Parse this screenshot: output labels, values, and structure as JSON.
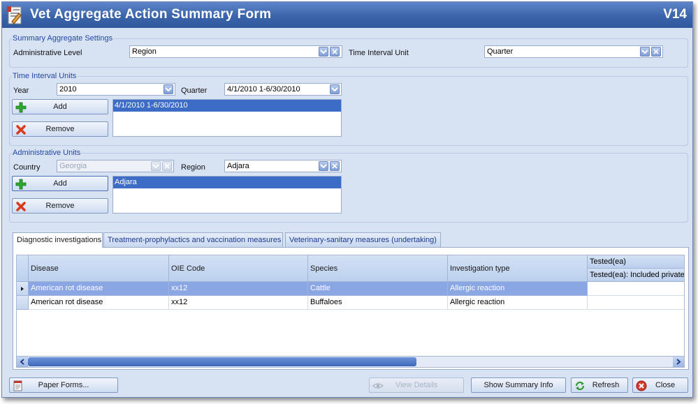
{
  "window": {
    "title": "Vet Aggregate Action Summary Form",
    "version": "V14"
  },
  "summary_settings": {
    "group_title": "Summary Aggregate Settings",
    "admin_level_label": "Administrative Level",
    "admin_level_value": "Region",
    "time_unit_label": "Time Interval Unit",
    "time_unit_value": "Quarter"
  },
  "time_interval_units": {
    "group_title": "Time Interval Units",
    "year_label": "Year",
    "year_value": "2010",
    "quarter_label": "Quarter",
    "quarter_value": "4/1/2010 1-6/30/2010",
    "add_label": "Add",
    "remove_label": "Remove",
    "list_items": [
      "4/1/2010 1-6/30/2010"
    ]
  },
  "administrative_units": {
    "group_title": "Administrative Units",
    "country_label": "Country",
    "country_value": "Georgia",
    "region_label": "Region",
    "region_value": "Adjara",
    "add_label": "Add",
    "remove_label": "Remove",
    "list_items": [
      "Adjara"
    ]
  },
  "tabs": [
    {
      "label": "Diagnostic investigations",
      "active": true
    },
    {
      "label": "Treatment-prophylactics and vaccination measures",
      "active": false
    },
    {
      "label": "Veterinary-sanitary measures (undertaking)",
      "active": false
    }
  ],
  "grid": {
    "columns": [
      "Disease",
      "OIE Code",
      "Species",
      "Investigation type"
    ],
    "group_column": "Tested(ea)",
    "group_subcolumn": "Tested(ea): Included private",
    "rows": [
      {
        "disease": "American rot disease",
        "oie": "xx12",
        "species": "Cattle",
        "type": "Allergic reaction",
        "selected": true
      },
      {
        "disease": "American rot disease",
        "oie": "xx12",
        "species": "Buffaloes",
        "type": "Allergic reaction",
        "selected": false
      }
    ]
  },
  "footer": {
    "paper_forms": "Paper Forms...",
    "view_details": "View Details",
    "show_summary_info": "Show Summary Info",
    "refresh": "Refresh",
    "close": "Close"
  },
  "colors": {
    "title_bar": "#3b64aa",
    "selection": "#3c6cc6",
    "group_title": "#2346a3"
  }
}
